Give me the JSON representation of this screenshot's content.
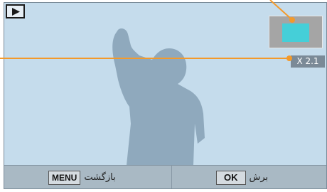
{
  "zoom": {
    "ratio_text": "X 2.1"
  },
  "bottom_bar": {
    "back": {
      "key_label": "MENU",
      "text": "بازگشت"
    },
    "crop": {
      "key_label": "OK",
      "text": "برش"
    }
  },
  "icons": {
    "play_mode": "play-triangle-icon"
  },
  "colors": {
    "screen_bg": "#c5dcec",
    "silhouette": "#8fa9bd",
    "bottom_bar": "#a9b9c4",
    "zoom_area": "#45cfd8",
    "zoom_nav_bg": "#a5a5a5",
    "callout": "#f39a2b"
  }
}
